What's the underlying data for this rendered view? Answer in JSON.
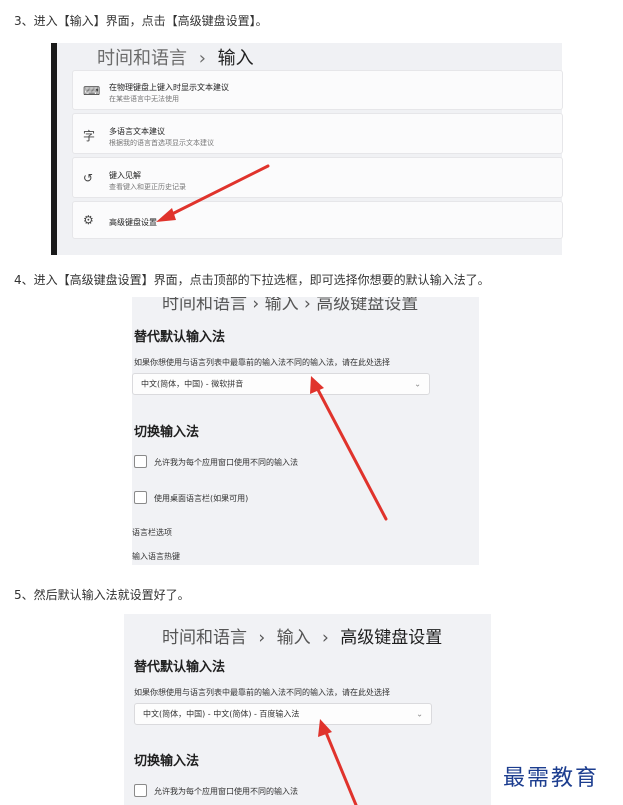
{
  "steps": {
    "s3": "3、进入【输入】界面，点击【高级键盘设置】。",
    "s4": "4、进入【高级键盘设置】界面，点击顶部的下拉选框，即可选择你想要的默认输入法了。",
    "s5": "5、然后默认输入法就设置好了。"
  },
  "shot1": {
    "breadcrumb": {
      "parent": "时间和语言",
      "sep": "›",
      "current": "输入"
    },
    "rows": [
      {
        "icon": "keyboard-icon",
        "title": "在物理键盘上键入时显示文本建议",
        "sub": "在某些语言中无法使用"
      },
      {
        "icon": "language-icon",
        "title": "多语言文本建议",
        "sub": "根据我的语言首选项显示文本建议"
      },
      {
        "icon": "history-icon",
        "title": "键入见解",
        "sub": "查看键入和更正历史记录"
      },
      {
        "icon": "gear-icon",
        "title": "高级键盘设置",
        "sub": ""
      }
    ]
  },
  "shot2": {
    "breadcrumb": "时间和语言 › 输入 › 高级键盘设置",
    "override_heading": "替代默认输入法",
    "override_desc": "如果你想使用与语言列表中最靠前的输入法不同的输入法，请在此处选择",
    "dropdown_value": "中文(简体，中国) - 微软拼音",
    "switch_heading": "切换输入法",
    "cb1": "允许我为每个应用窗口使用不同的输入法",
    "cb2": "使用桌面语言栏(如果可用)",
    "link1": "语言栏选项",
    "link2": "输入语言热键"
  },
  "shot3": {
    "breadcrumb": {
      "a": "时间和语言",
      "sep1": "›",
      "b": "输入",
      "sep2": "›",
      "c": "高级键盘设置"
    },
    "override_heading": "替代默认输入法",
    "override_desc": "如果你想使用与语言列表中最靠前的输入法不同的输入法，请在此处选择",
    "dropdown_value": "中文(简体，中国) - 中文(简体) - 百度输入法",
    "switch_heading": "切换输入法",
    "cb1": "允许我为每个应用窗口使用不同的输入法"
  },
  "watermark": "最需教育",
  "colors": {
    "arrow": "#e0332c",
    "watermark": "#1c3d8f"
  }
}
